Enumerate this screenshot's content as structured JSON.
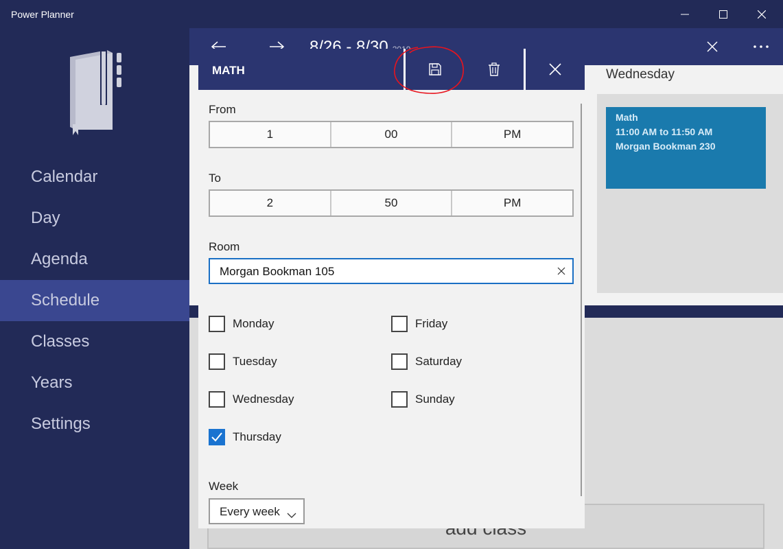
{
  "window": {
    "title": "Power Planner"
  },
  "sidebar": {
    "items": [
      {
        "label": "Calendar"
      },
      {
        "label": "Day"
      },
      {
        "label": "Agenda"
      },
      {
        "label": "Schedule",
        "active": true
      },
      {
        "label": "Classes"
      },
      {
        "label": "Years"
      },
      {
        "label": "Settings"
      }
    ]
  },
  "main": {
    "date_range": "8/26 - 8/30",
    "year": "2019",
    "day_header": "Wednesday",
    "class_block": {
      "name": "Math",
      "time": "11:00 AM to 11:50 AM",
      "room": "Morgan Bookman 230"
    },
    "add_class_label": "add class"
  },
  "dialog": {
    "title": "MATH",
    "from_label": "From",
    "from": {
      "hour": "1",
      "minute": "00",
      "ampm": "PM"
    },
    "to_label": "To",
    "to": {
      "hour": "2",
      "minute": "50",
      "ampm": "PM"
    },
    "room_label": "Room",
    "room_value": "Morgan Bookman 105",
    "days": {
      "monday": {
        "label": "Monday",
        "checked": false
      },
      "tuesday": {
        "label": "Tuesday",
        "checked": false
      },
      "wednesday": {
        "label": "Wednesday",
        "checked": false
      },
      "thursday": {
        "label": "Thursday",
        "checked": true
      },
      "friday": {
        "label": "Friday",
        "checked": false
      },
      "saturday": {
        "label": "Saturday",
        "checked": false
      },
      "sunday": {
        "label": "Sunday",
        "checked": false
      }
    },
    "week_label": "Week",
    "week_value": "Every week"
  },
  "colors": {
    "sidebar_bg": "#222a57",
    "header_bg": "#2b3570",
    "active_nav": "#3a4790",
    "class_block": "#1a7aad",
    "checkbox_accent": "#1a73d0",
    "annotation": "#e8141e"
  }
}
